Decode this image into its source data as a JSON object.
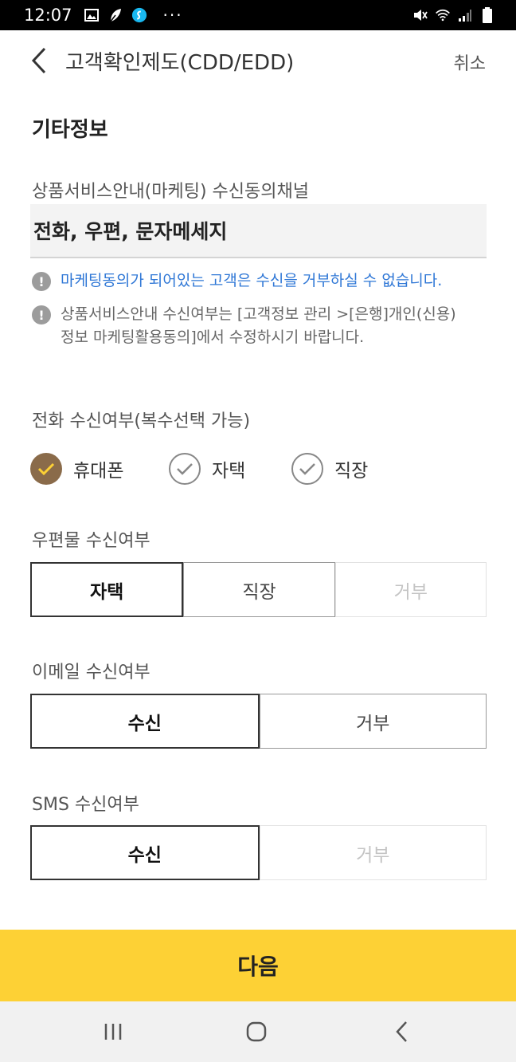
{
  "status_bar": {
    "time": "12:07",
    "more": "···",
    "icons": [
      "gallery-icon",
      "leaf-icon",
      "shazam-icon",
      "mute-icon",
      "wifi-icon",
      "signal-icon",
      "battery-icon"
    ]
  },
  "header": {
    "title": "고객확인제도(CDD/EDD)",
    "cancel": "취소"
  },
  "section": {
    "title": "기타정보"
  },
  "marketing": {
    "label": "상품서비스안내(마케팅) 수신동의채널",
    "value": "전화, 우편, 문자메세지",
    "notice1": "마케팅동의가 되어있는 고객은 수신을 거부하실 수 없습니다.",
    "notice2_line1": "상품서비스안내 수신여부는 [고객정보 관리 >[은행]개인(신용)",
    "notice2_line2": "정보 마케팅활용동의]에서 수정하시기 바랍니다."
  },
  "phone": {
    "label": "전화 수신여부(복수선택 가능)",
    "options": [
      {
        "label": "휴대폰",
        "checked": true
      },
      {
        "label": "자택",
        "checked": false
      },
      {
        "label": "직장",
        "checked": false
      }
    ]
  },
  "mail": {
    "label": "우편물 수신여부",
    "options": [
      "자택",
      "직장",
      "거부"
    ],
    "selected": "자택"
  },
  "email": {
    "label": "이메일 수신여부",
    "options": [
      "수신",
      "거부"
    ],
    "selected": "수신"
  },
  "sms": {
    "label": "SMS 수신여부",
    "options": [
      "수신",
      "거부"
    ],
    "selected": "수신"
  },
  "next_button": "다음",
  "colors": {
    "accent_yellow": "#fdd135",
    "check_on": "#8a6b4a",
    "notice_blue": "#2f77d6"
  }
}
